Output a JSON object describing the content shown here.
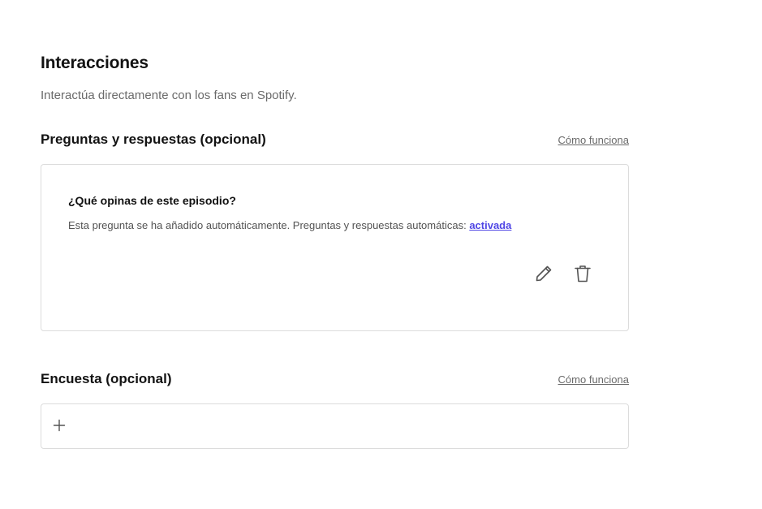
{
  "section": {
    "title": "Interacciones",
    "subtitle": "Interactúa directamente con los fans en Spotify."
  },
  "qa": {
    "title": "Preguntas y respuestas (opcional)",
    "help_link": "Cómo funciona",
    "question": "¿Qué opinas de este episodio?",
    "note": "Esta pregunta se ha añadido automáticamente. Preguntas y respuestas automáticas:",
    "status_link": "activada",
    "edit_icon": "pencil-icon",
    "delete_icon": "trash-icon"
  },
  "poll": {
    "title": "Encuesta (opcional)",
    "help_link": "Cómo funciona",
    "add_icon": "plus-icon"
  },
  "colors": {
    "link_accent": "#4f46e5",
    "text_primary": "#121212",
    "text_secondary": "#6a6a6a",
    "border": "#dcdcdc",
    "icon": "#535353"
  }
}
